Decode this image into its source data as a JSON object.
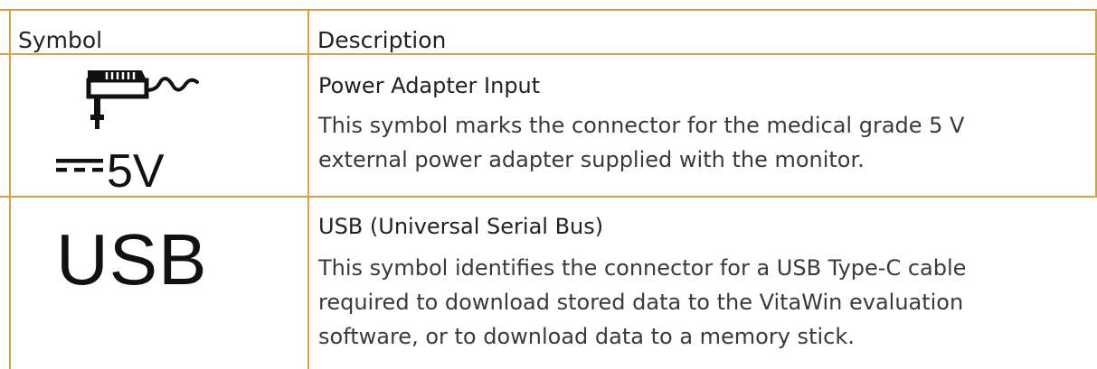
{
  "table": {
    "header": {
      "symbol": "Symbol",
      "description": "Description"
    },
    "rows": [
      {
        "symbol_icon": "power-adapter-icon",
        "symbol_caption": "5V",
        "title": "Power Adapter Input",
        "lines": [
          "This symbol marks the connector for the medical grade 5 V",
          "external power adapter supplied with the monitor."
        ]
      },
      {
        "symbol_text": "USB",
        "title": "USB (Universal Serial Bus)",
        "lines": [
          "This symbol identifies the connector for a USB Type-C cable",
          "required to download stored data to the VitaWin evaluation",
          "software, or to download data to a memory stick."
        ]
      }
    ]
  },
  "colors": {
    "border": "#d9a040",
    "text": "#222222"
  }
}
